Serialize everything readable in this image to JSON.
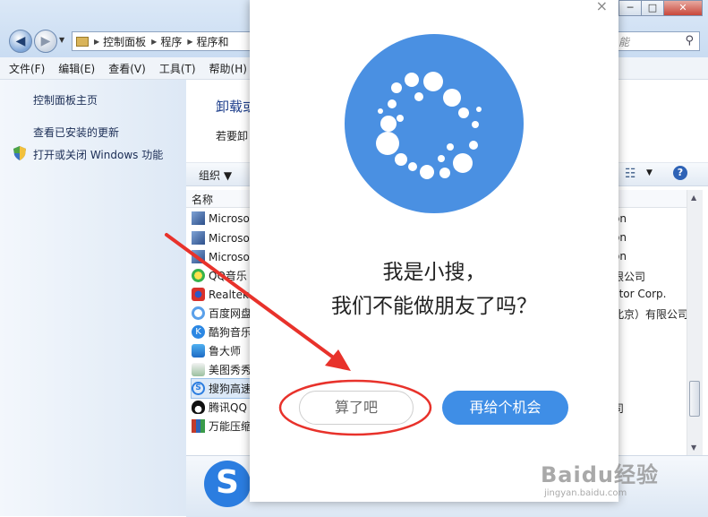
{
  "explorer": {
    "address": [
      "控制面板",
      "程序",
      "程序和"
    ],
    "search_placeholder": "能",
    "menu": [
      "文件(F)",
      "编辑(E)",
      "查看(V)",
      "工具(T)",
      "帮助(H)"
    ],
    "left_links": [
      "控制面板主页",
      "查看已安装的更新",
      "打开或关闭 Windows 功能"
    ],
    "main_title": "卸载或",
    "main_subtitle": "若要卸",
    "organize_label": "组织",
    "column_name": "名称",
    "programs": [
      {
        "name": "Microso",
        "right": "on"
      },
      {
        "name": "Microso",
        "right": "on"
      },
      {
        "name": "Microso",
        "right": "on"
      },
      {
        "name": "QQ音乐",
        "right": "限公司"
      },
      {
        "name": "Realtek",
        "right": "ctor Corp."
      },
      {
        "name": "百度网盘",
        "right": "北京）有限公司"
      },
      {
        "name": "酷狗音乐",
        "right": ""
      },
      {
        "name": "鲁大师",
        "right": ""
      },
      {
        "name": "美图秀秀",
        "right": ""
      },
      {
        "name": "搜狗高速",
        "right": ""
      },
      {
        "name": "腾讯QQ",
        "right": "司"
      },
      {
        "name": "万能压缩",
        "right": ""
      }
    ],
    "window_controls": [
      "─",
      "□",
      "✕"
    ]
  },
  "dialog": {
    "close_label": "×",
    "message_line1": "我是小搜，",
    "message_line2": "我们不能做朋友了吗？",
    "quit_button": "算了吧",
    "stay_button": "再给个机会"
  },
  "watermark": {
    "main": "Baidu经验",
    "sub": "jingyan.baidu.com"
  },
  "colors": {
    "accent_blue": "#3f8ee6",
    "mascot_blue": "#4a90e2",
    "annotation_red": "#e8322b"
  }
}
